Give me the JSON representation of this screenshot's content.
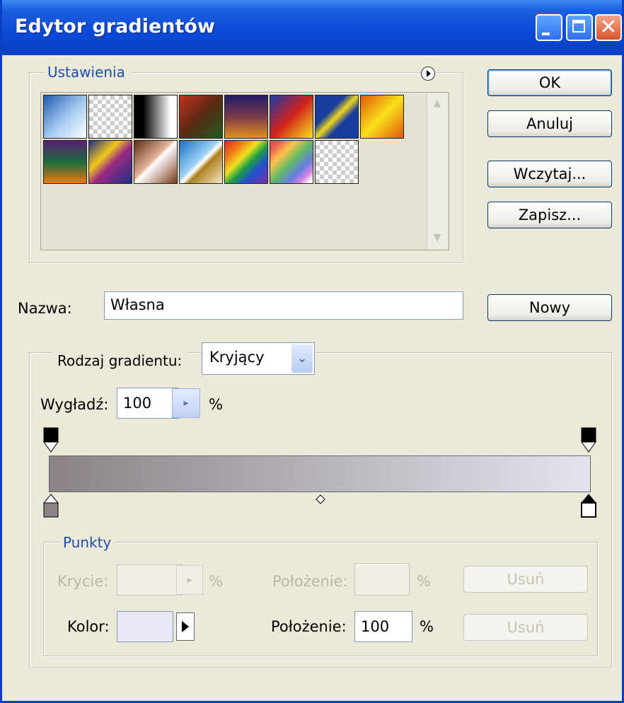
{
  "window": {
    "title": "Edytor gradientów"
  },
  "presets": {
    "legend": "Ustawienia",
    "swatches": [
      "blue-white",
      "transparent-stripes",
      "black-white",
      "red-green",
      "violet-orange",
      "blue-red-yellow",
      "blue-yellow-blue",
      "orange-yellow-orange",
      "violet-green-orange",
      "blue-yellow-blue-2",
      "copper",
      "chrome",
      "spectrum",
      "transparent-rainbow",
      "transparent-checker"
    ]
  },
  "buttons": {
    "ok": "OK",
    "cancel": "Anuluj",
    "load": "Wczytaj...",
    "save": "Zapisz...",
    "new": "Nowy"
  },
  "name": {
    "label": "Nazwa:",
    "value": "Własna"
  },
  "gradient_type": {
    "legend": "Rodzaj gradientu:",
    "value": "Kryjący"
  },
  "smoothness": {
    "label": "Wygładź:",
    "value": "100",
    "unit": "%"
  },
  "gradient_bar": {
    "colors": [
      "#8a8286",
      "#e4e4ee"
    ]
  },
  "stops": {
    "legend": "Punkty",
    "opacity_label": "Krycie:",
    "opacity_unit": "%",
    "position_label": "Położenie:",
    "position_unit": "%",
    "delete": "Usuń",
    "color_label": "Kolor:",
    "color_value": "#e8e8f4",
    "color_position_label": "Położenie:",
    "color_position_value": "100",
    "color_position_unit": "%",
    "color_delete": "Usuń"
  }
}
